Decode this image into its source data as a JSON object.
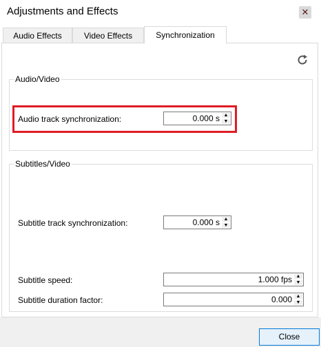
{
  "window": {
    "title": "Adjustments and Effects",
    "close_glyph": "✕"
  },
  "tabs": [
    {
      "label": "Audio Effects",
      "active": false
    },
    {
      "label": "Video Effects",
      "active": false
    },
    {
      "label": "Synchronization",
      "active": true
    }
  ],
  "audio_video": {
    "group_title": "Audio/Video",
    "audio_sync": {
      "label": "Audio track synchronization:",
      "value": "0.000 s"
    }
  },
  "subtitles_video": {
    "group_title": "Subtitles/Video",
    "subtitle_sync": {
      "label": "Subtitle track synchronization:",
      "value": "0.000 s"
    },
    "subtitle_speed": {
      "label": "Subtitle speed:",
      "value": "1.000 fps"
    },
    "subtitle_duration": {
      "label": "Subtitle duration factor:",
      "value": "0.000"
    }
  },
  "footer": {
    "close_label": "Close"
  },
  "icons": {
    "reset": "refresh-icon",
    "spin_up": "spin-up-arrow-icon",
    "spin_down": "spin-down-arrow-icon"
  },
  "colors": {
    "highlight": "#e01b24",
    "focus_border": "#0078d7"
  }
}
